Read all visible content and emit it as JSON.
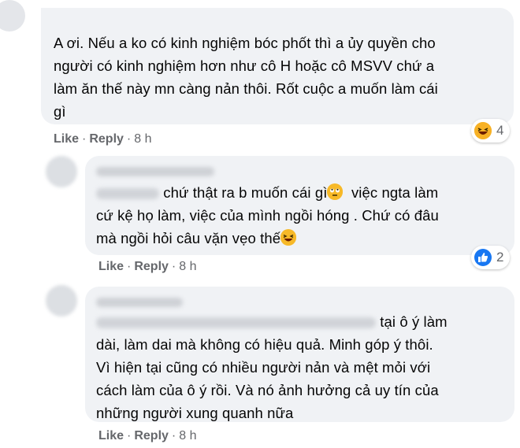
{
  "comments": [
    {
      "text_lines": [
        "A ơi. Nếu a ko có kinh nghiệm bóc phốt thì a ủy quyền cho",
        "người có kinh nghiệm hơn như cô H hoặc cô MSVV chứ a",
        "làm ăn thế này mn càng nản thôi. Rốt cuộc a muốn làm cái",
        "gì"
      ],
      "reaction": {
        "type": "haha-icon",
        "count": "4"
      },
      "actions": {
        "like": "Like",
        "reply": "Reply",
        "time": "8 h",
        "separator": "·"
      }
    },
    {
      "text_lines": [
        "chứ thật ra b muốn cái gì",
        "việc ngta làm",
        "cứ kệ họ làm, việc của mình ngồi hóng . Chứ có đâu",
        "mà ngồi hỏi câu vặn vẹo thế"
      ],
      "reaction": {
        "type": "like-icon",
        "count": "2"
      },
      "actions": {
        "like": "Like",
        "reply": "Reply",
        "time": "8 h",
        "separator": "·"
      }
    },
    {
      "text_lines": [
        "tại ô ý làm",
        "dài, làm dai mà không có hiệu quả. Minh góp ý thôi.",
        "Vì hiện tại cũng có nhiều người nản và mệt mỏi với",
        "cách làm của ô ý rồi. Và nó ảnh hưởng cả uy tín của",
        "những người xung quanh nữa"
      ],
      "actions": {
        "like": "Like",
        "reply": "Reply",
        "time": "8 h",
        "separator": "·"
      }
    }
  ],
  "colors": {
    "bubble": "#f0f2f5",
    "meta": "#65676b",
    "text": "#050505",
    "like_blue": "#1877f2",
    "haha_yellow": "#f7b125"
  }
}
